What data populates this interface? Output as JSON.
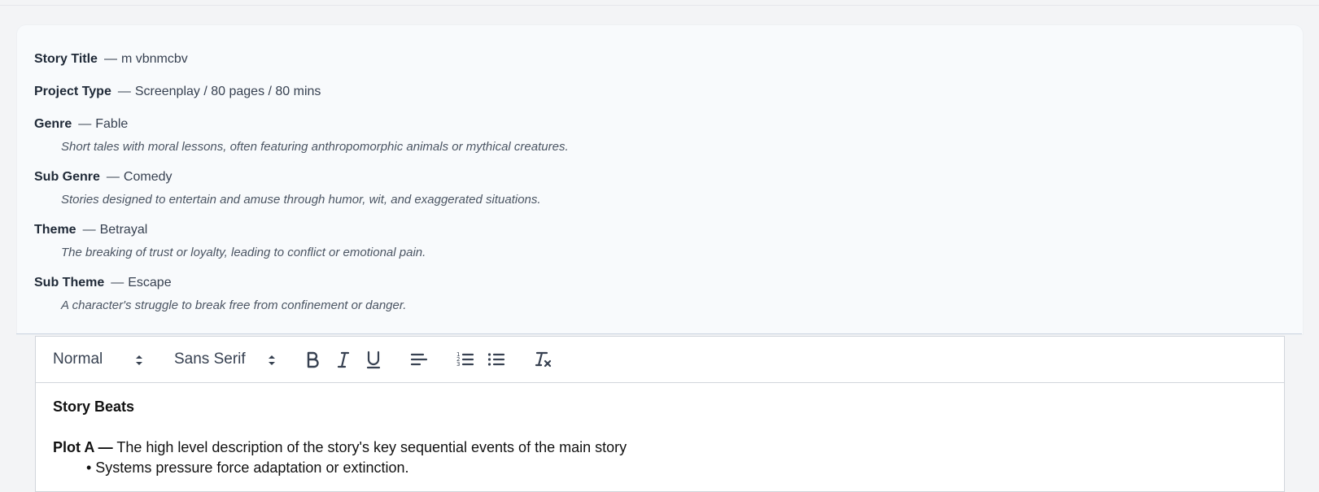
{
  "meta": {
    "items": [
      {
        "label": "Story Title",
        "value": "m vbnmcbv",
        "desc": ""
      },
      {
        "label": "Project Type",
        "value": "Screenplay / 80 pages / 80 mins",
        "desc": ""
      },
      {
        "label": "Genre",
        "value": "Fable",
        "desc": "Short tales with moral lessons, often featuring anthropomorphic animals or mythical creatures."
      },
      {
        "label": "Sub Genre",
        "value": "Comedy",
        "desc": "Stories designed to entertain and amuse through humor, wit, and exaggerated situations."
      },
      {
        "label": "Theme",
        "value": "Betrayal",
        "desc": "The breaking of trust or loyalty, leading to conflict or emotional pain."
      },
      {
        "label": "Sub Theme",
        "value": "Escape",
        "desc": "A character's struggle to break free from confinement or danger."
      }
    ],
    "dash": "—"
  },
  "toolbar": {
    "heading_select": "Normal",
    "font_select": "Sans Serif",
    "icons": [
      "bold-icon",
      "italic-icon",
      "underline-icon",
      "align-left-icon",
      "ordered-list-icon",
      "bullet-list-icon",
      "clear-format-icon"
    ]
  },
  "editor": {
    "title": "Story Beats",
    "plot_label": "Plot A —",
    "plot_text": " The high level description of the story's key sequential events of the main story",
    "bullet": "• Systems pressure force adaptation or extinction."
  },
  "colors": {
    "page_bg": "#f3f4f6",
    "card_bg": "#f8fafc",
    "text_dark": "#1f2937",
    "text_muted": "#4b5563",
    "editor_border": "#d1d5db"
  }
}
